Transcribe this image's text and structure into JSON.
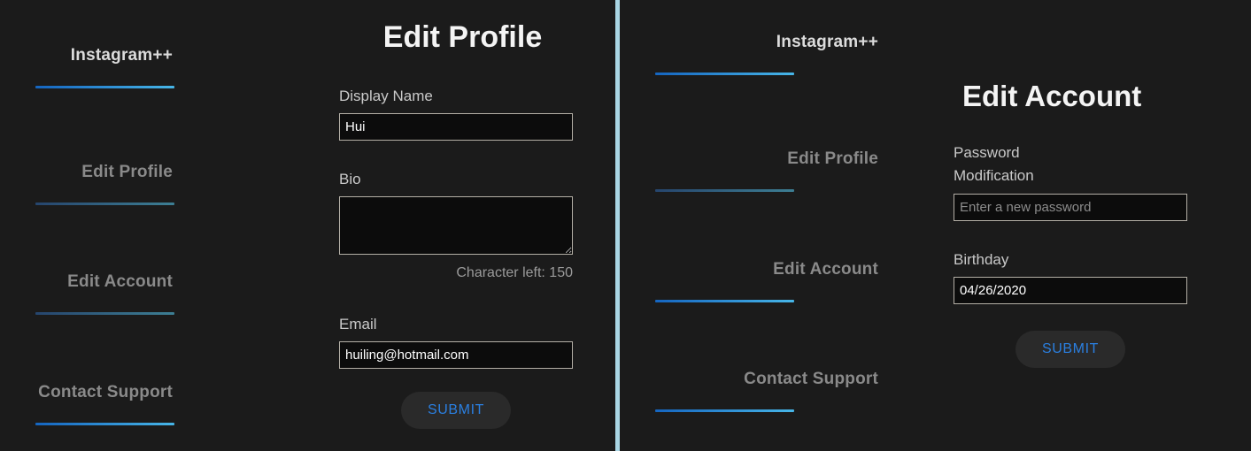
{
  "brand": "Instagram++",
  "divider_color": "#a9d5e4",
  "background_color": "#1b1b1b",
  "accent_color": "#2a7fe0",
  "rule_gradient_bright": [
    "#1565c0",
    "#47b6e8"
  ],
  "rule_gradient_muted": [
    "#26456d",
    "#3d7f94"
  ],
  "panels": {
    "left": {
      "sidebar": {
        "brand": "Instagram++",
        "items": [
          {
            "label": "Edit Profile",
            "rule": "muted"
          },
          {
            "label": "Edit Account",
            "rule": "muted"
          },
          {
            "label": "Contact Support",
            "rule": "bright"
          }
        ]
      },
      "main": {
        "title": "Edit Profile",
        "display_name": {
          "label": "Display Name",
          "value": "Hui",
          "placeholder": ""
        },
        "bio": {
          "label": "Bio",
          "value": "",
          "placeholder": "",
          "char_count": "Character left: 150"
        },
        "email": {
          "label": "Email",
          "value": "huiling@hotmail.com",
          "placeholder": ""
        },
        "submit_label": "SUBMIT"
      }
    },
    "right": {
      "sidebar": {
        "brand": "Instagram++",
        "items": [
          {
            "label": "Edit Profile",
            "rule": "muted"
          },
          {
            "label": "Edit Account",
            "rule": "bright"
          },
          {
            "label": "Contact Support",
            "rule": "bright"
          }
        ]
      },
      "main": {
        "title": "Edit Account",
        "password": {
          "label_line1": "Password",
          "label_line2": "Modification",
          "value": "",
          "placeholder": "Enter a new password"
        },
        "birthday": {
          "label": "Birthday",
          "value": "04/26/2020",
          "placeholder": ""
        },
        "submit_label": "SUBMIT"
      }
    }
  }
}
